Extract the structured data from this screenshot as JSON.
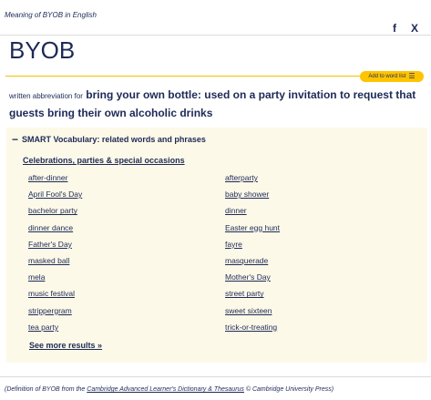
{
  "header": {
    "meaning_label": "Meaning of BYOB in English",
    "social": {
      "facebook_icon": "f",
      "x_icon": "X"
    }
  },
  "entry": {
    "headword": "BYOB",
    "add_to_list_label": "Add to word list",
    "add_to_list_icon": "☰",
    "grammar": "written abbreviation for",
    "definition": "bring your own bottle: used on a party invitation to request that guests bring their own alcoholic drinks"
  },
  "smart_vocab": {
    "toggle_icon": "−",
    "title": "SMART Vocabulary: related words and phrases",
    "category": "Celebrations, parties & special occasions",
    "left_words": [
      "after-dinner",
      "April Fool's Day",
      "bachelor party",
      "dinner dance",
      "Father's Day",
      "masked ball",
      "mela",
      "music festival",
      "strippergram",
      "tea party"
    ],
    "right_words": [
      "afterparty",
      "baby shower",
      "dinner",
      "Easter egg hunt",
      "fayre",
      "masquerade",
      "Mother's Day",
      "street party",
      "sweet sixteen",
      "trick-or-treating"
    ],
    "see_more": "See more results »"
  },
  "footer": {
    "prefix": "(Definition of BYOB from the ",
    "source_link": "Cambridge Advanced Learner's Dictionary & Thesaurus",
    "suffix": " © Cambridge University Press)"
  }
}
